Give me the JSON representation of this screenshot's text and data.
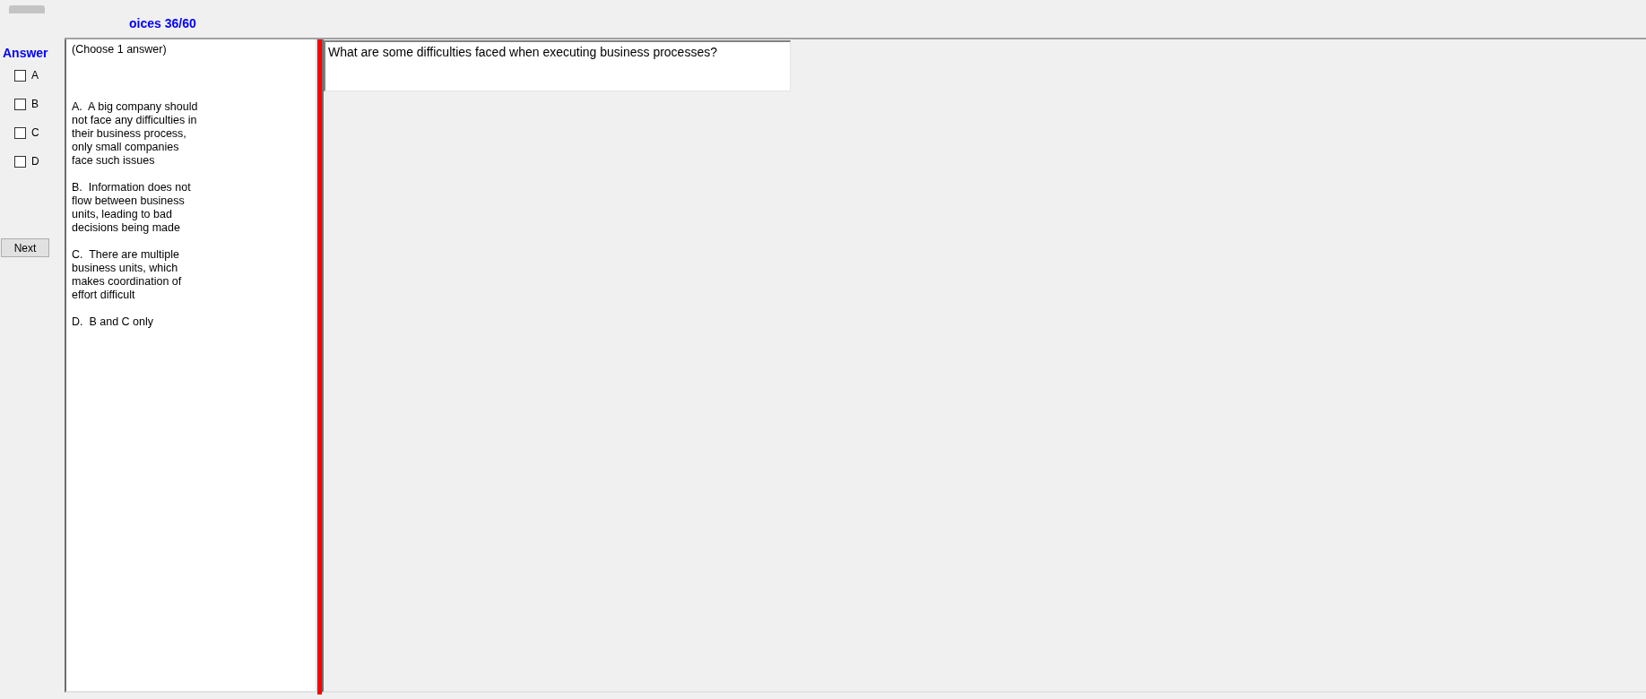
{
  "title": "oices 36/60",
  "answer_panel": {
    "heading": "Answer",
    "choices": [
      {
        "label": "A",
        "checked": false
      },
      {
        "label": "B",
        "checked": false
      },
      {
        "label": "C",
        "checked": false
      },
      {
        "label": "D",
        "checked": false
      }
    ],
    "next_button": "Next"
  },
  "options_panel": {
    "instruction": "(Choose 1 answer)",
    "options": [
      "A.  A big company should not face any difficulties in their business process, only small companies face such issues",
      "B.  Information does not flow between business units, leading to bad decisions being made",
      "C.  There are multiple business units, which makes coordination of effort difficult",
      "D.  B and C only"
    ]
  },
  "question": "What are some difficulties faced when executing business processes?"
}
